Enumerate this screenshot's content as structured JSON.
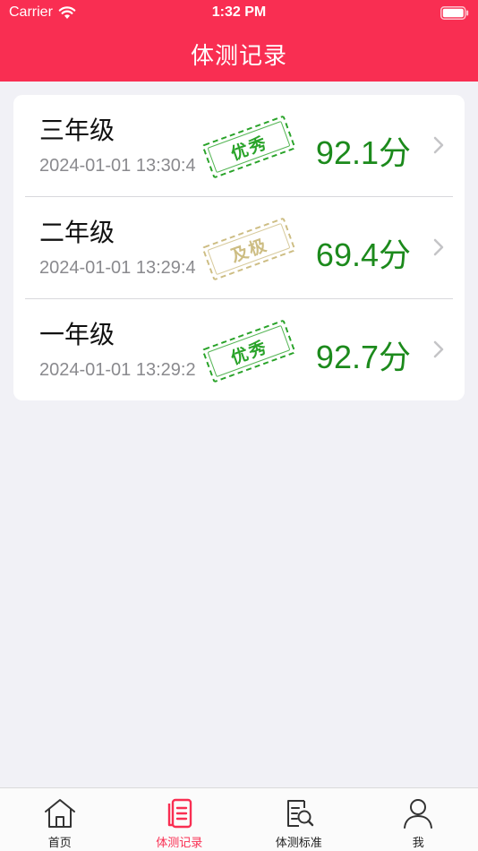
{
  "status_bar": {
    "carrier": "Carrier",
    "time": "1:32 PM"
  },
  "nav": {
    "title": "体测记录"
  },
  "records": [
    {
      "grade": "三年级",
      "timestamp": "2024-01-01 13:30:4",
      "badge": "优秀",
      "badge_color": "#29a329",
      "score": "92.1分"
    },
    {
      "grade": "二年级",
      "timestamp": "2024-01-01 13:29:4",
      "badge": "及极",
      "badge_color": "#cdbd83",
      "score": "69.4分"
    },
    {
      "grade": "一年级",
      "timestamp": "2024-01-01 13:29:2",
      "badge": "优秀",
      "badge_color": "#29a329",
      "score": "92.7分"
    }
  ],
  "tabs": [
    {
      "label": "首页",
      "icon": "home-icon",
      "active": false
    },
    {
      "label": "体测记录",
      "icon": "records-icon",
      "active": true
    },
    {
      "label": "体测标准",
      "icon": "standard-search-icon",
      "active": false
    },
    {
      "label": "我",
      "icon": "user-icon",
      "active": false
    }
  ],
  "colors": {
    "brand": "#f92e52",
    "score": "#1c8a1c",
    "background": "#f1f1f6"
  }
}
